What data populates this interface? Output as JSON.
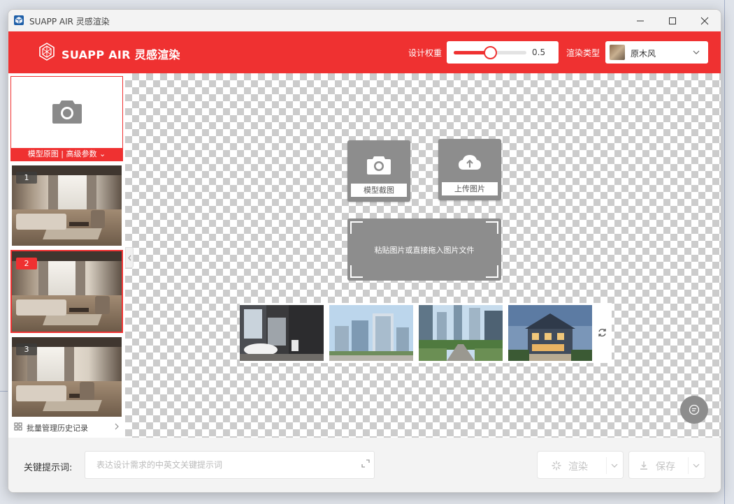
{
  "window": {
    "title": "SUAPP AIR 灵感渲染"
  },
  "header": {
    "brand": "SUAPP AIR 灵感渲染",
    "weight_label": "设计权重",
    "weight_value": "0.5",
    "weight_fraction": 0.5,
    "render_type_label": "渲染类型",
    "render_type_value": "原木风",
    "accent_color": "#ef3131"
  },
  "sidebar": {
    "upload_label": "模型原图 | 高级参数",
    "thumbnails": [
      {
        "number": "1",
        "active": false
      },
      {
        "number": "2",
        "active": true
      },
      {
        "number": "3",
        "active": false
      }
    ],
    "history_label": "批量管理历史记录"
  },
  "canvas": {
    "screenshot_label": "模型截图",
    "upload_label": "上传图片",
    "drop_text": "粘贴图片或直接拖入图片文件",
    "sample_names": [
      "bathroom-sample",
      "office-towers-sample",
      "city-street-sample",
      "villa-sample"
    ]
  },
  "bottom": {
    "prompt_label": "关键提示词:",
    "prompt_placeholder": "表达设计需求的中英文关键提示词",
    "render_label": "渲染",
    "save_label": "保存"
  },
  "icons": {
    "app": "sketchup-cube-icon",
    "logo": "diamond-logo-icon",
    "camera": "camera-icon",
    "upload": "cloud-upload-icon",
    "refresh": "refresh-icon",
    "chat": "chat-icon",
    "grid": "grid-icon",
    "expand": "expand-icon",
    "render": "sparkle-icon",
    "save": "download-icon"
  }
}
